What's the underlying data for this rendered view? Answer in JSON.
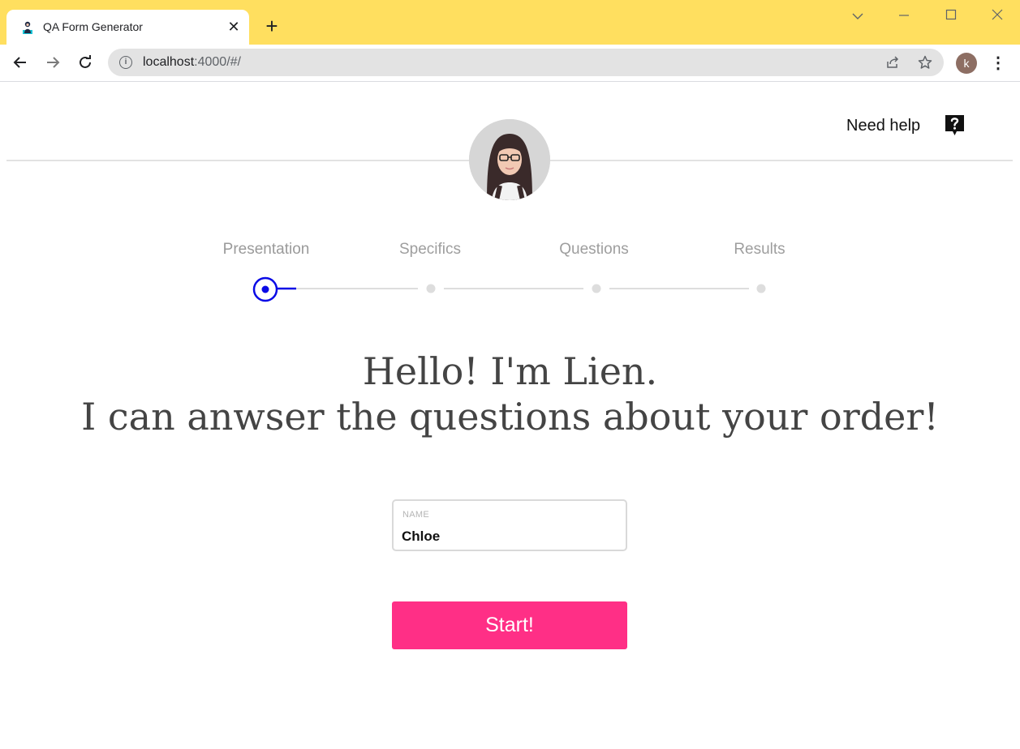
{
  "browser": {
    "tab_title": "QA Form Generator",
    "tab_close": "✕",
    "new_tab": "+",
    "url_host": "localhost",
    "url_rest": ":4000/#/",
    "profile_initial": "k",
    "menu": "⋮",
    "colors": {
      "titlebar": "#ffdf5f",
      "omnibox": "#e3e3e3"
    }
  },
  "header": {
    "help_text": "Need help",
    "help_icon": "question-bubble-icon"
  },
  "steps": {
    "items": [
      {
        "label": "Presentation",
        "state": "active"
      },
      {
        "label": "Specifics",
        "state": "pending"
      },
      {
        "label": "Questions",
        "state": "pending"
      },
      {
        "label": "Results",
        "state": "pending"
      }
    ],
    "active_color": "#0a0ae6",
    "inactive_color": "#dddddd"
  },
  "hero": {
    "line1": "Hello! I'm Lien.",
    "line2": "I can anwser the questions about your order!"
  },
  "form": {
    "name_label": "NAME",
    "name_value": "Chloe",
    "start_label": "Start!",
    "button_color": "#ff2f86"
  }
}
